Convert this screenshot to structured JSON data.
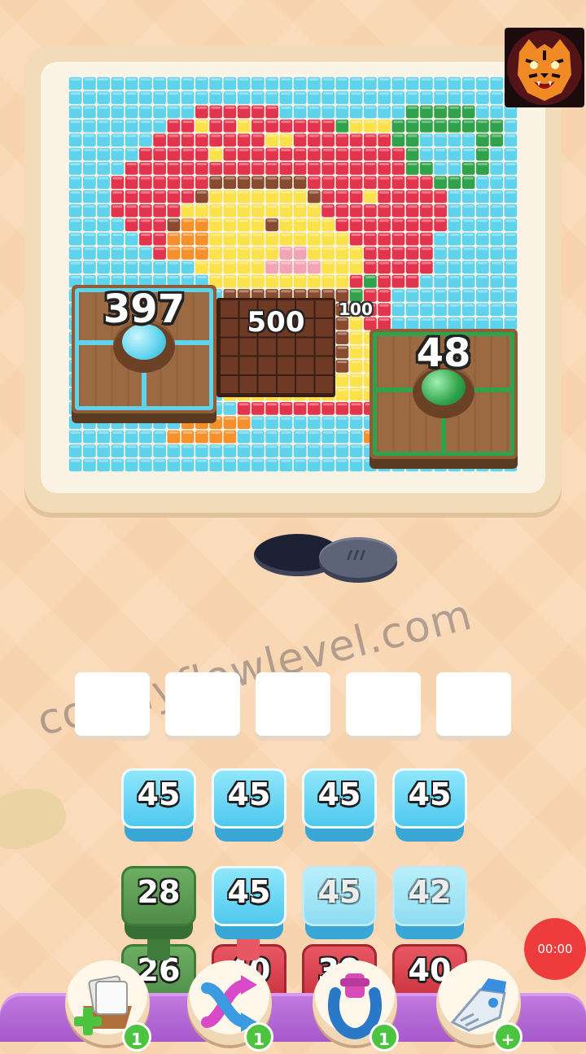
{
  "board": {
    "cols": 32,
    "rows": 28,
    "palette": {
      "b": "#5fd3ec",
      "r": "#e3344d",
      "p": "#f2a3b5",
      "y": "#fbe14a",
      "o": "#f5902b",
      "g": "#2fa24b",
      "n": "#8a4a2f",
      "w": "#fff9d8"
    },
    "grid": [
      "bbbbbbbbbbbbbbbbbbbbbbbbbbbbbbbb",
      "bbbbbbbbbbbbbbbbbbbbbbbbbbbbbbbb",
      "bbbbbbbbbrrrrrrbbbbbbbbbgggggbbb",
      "bbbbbbbrryrryrrrrrrgyyyggggggggb",
      "bbbbbbrrrrrrrryyrrrrrrrggbbbbggb",
      "bbbbbrrrrryrrrrrrrrrrrrrgbbbbgbb",
      "bbbbrrrrrrrrrrrrrrrrrrrrggbbggbb",
      "bbbrrrrrrrnnnnnnnrrrrrrrrrgggbbb",
      "bbbrrrrrrnyyyyyyynrrryrrrrrbbbbb",
      "bbbrrrrryyyyyyyyyyrrrrrrrrrbbbbb",
      "bbbbrrrnooyyyynyyyyrrrrrrrrbbbbb",
      "bbbbbrroooyyyyyyyyyyrrrrrrbbbbbb",
      "bbbbbbroooyyyyyppyyyyrrrrrbbbbbb",
      "bbbbbbbbbyyyyyppppyyyrrrrrbbbbbb",
      "bbbbbbbbbbyyyyyyyyyyrgrrrbbbbbbb",
      "bbbbbbbbbbbnnnnnnnnngrrbbbbbbbbb",
      "bbbbbbbbbbbnnnnnnnnnrrrbbbbbbbbb",
      "bbbbbbbbbbbnnnnnnnnnyrrbbbbbbbbb",
      "bbbbbbbbbbbnnnnnnnnnyyrbbbbbbbbb",
      "bbbbbbbbbbbnnnnnnnnnyyybbbbbbbbb",
      "bbbbbbbbbbbnnnnnnnnnyyyybbbbbbbb",
      "bbbbbbbbbbbyyyyyyyyyyyybbbbbbbbb",
      "bbbbbbbbbbbyyyyyyyyyyyybbbbbbbbb",
      "bbbbbbbbbbbbrrrrrrrrrrrbbbbbbbbb",
      "bbbbbbbbooooobbbbbbbbbobbbbbbbbb",
      "bbbbbbbooooobbbbbbbbbooobbbbbbbb",
      "bbbbbbbbbbbbbbbbbbbbbbbbbbbbbbbb",
      "bbbbbbbbbbbbbbbbbbbbbbbbbbbbbbbb"
    ]
  },
  "crates": {
    "left_count": "397",
    "left_color": "#5fd3ec",
    "right_count": "48",
    "right_color": "#2fa24b"
  },
  "chocolate_count": "500",
  "small_count": "100",
  "watermark": "colonyflowlevel.com",
  "slots_empty": 5,
  "tiles": {
    "row1": [
      "45",
      "45",
      "45",
      "45"
    ],
    "row2": [
      "28",
      "45",
      "45",
      "42"
    ],
    "row3": [
      "26",
      "40",
      "39",
      "40"
    ]
  },
  "timer": "00:00",
  "powerups": [
    {
      "icon": "add-card-icon",
      "count": "1"
    },
    {
      "icon": "shuffle-icon",
      "count": "1"
    },
    {
      "icon": "magnet-icon",
      "count": "1"
    },
    {
      "icon": "vacuum-icon",
      "count": "+"
    }
  ]
}
